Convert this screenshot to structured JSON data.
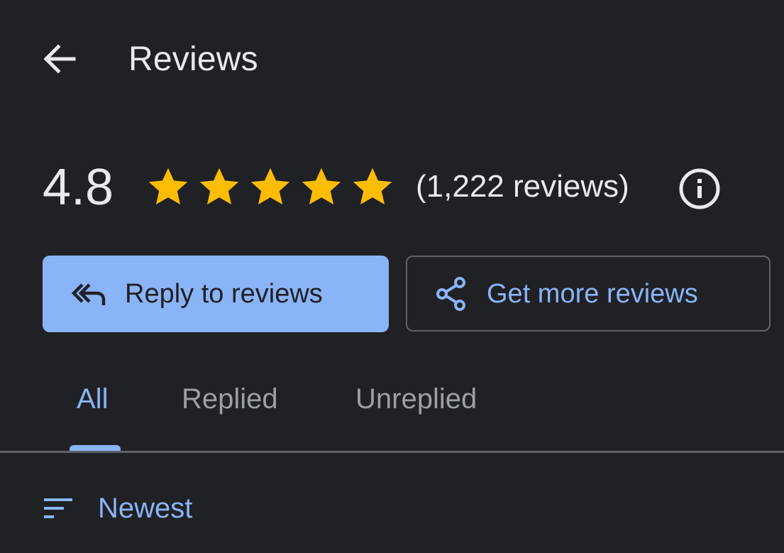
{
  "header": {
    "title": "Reviews",
    "back_icon": "arrow-back-icon"
  },
  "rating": {
    "value": "4.8",
    "stars": 5,
    "star_color": "#fbbc04",
    "count_text": "(1,222 reviews)",
    "info_icon": "info-icon"
  },
  "actions": {
    "reply_label": "Reply to reviews",
    "reply_icon": "reply-all-icon",
    "more_label": "Get more reviews",
    "more_icon": "share-icon"
  },
  "tabs": {
    "items": [
      {
        "label": "All",
        "selected": true
      },
      {
        "label": "Replied",
        "selected": false
      },
      {
        "label": "Unreplied",
        "selected": false
      }
    ]
  },
  "sort": {
    "label": "Newest",
    "icon": "sort-icon"
  },
  "colors": {
    "background": "#202124",
    "accent": "#8ab4f8",
    "text_primary": "#e8eaed",
    "text_secondary": "#9aa0a6",
    "divider": "#5f6368"
  }
}
